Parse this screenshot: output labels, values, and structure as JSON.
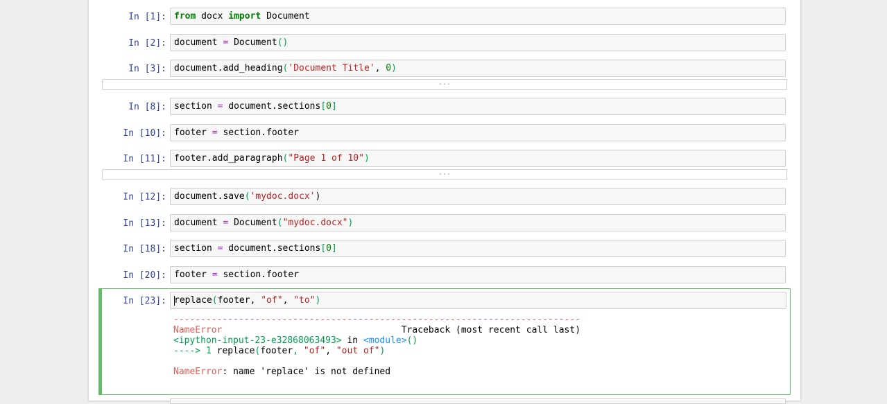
{
  "cells": [
    {
      "prompt": "In [1]:",
      "code": [
        [
          "from",
          "kw"
        ],
        [
          " docx ",
          ""
        ],
        [
          "import",
          "kw"
        ],
        [
          " Document",
          ""
        ]
      ]
    },
    {
      "prompt": "In [2]:",
      "code": [
        [
          "document ",
          ""
        ],
        [
          "=",
          "op"
        ],
        [
          " Document",
          ""
        ],
        [
          "()",
          "grn"
        ]
      ]
    },
    {
      "prompt": "In [3]:",
      "code": [
        [
          "document.add_heading",
          ""
        ],
        [
          "(",
          "grn"
        ],
        [
          "'Document Title'",
          "str"
        ],
        [
          ", ",
          ""
        ],
        [
          "0",
          "num"
        ],
        [
          ")",
          "grn"
        ]
      ]
    },
    {
      "prompt": "In [8]:",
      "code": [
        [
          "section ",
          ""
        ],
        [
          "=",
          "op"
        ],
        [
          " document.sections",
          ""
        ],
        [
          "[",
          "grn"
        ],
        [
          "0",
          "num"
        ],
        [
          "]",
          "grn"
        ]
      ]
    },
    {
      "prompt": "In [10]:",
      "code": [
        [
          "footer ",
          ""
        ],
        [
          "=",
          "op"
        ],
        [
          " section.footer",
          ""
        ]
      ]
    },
    {
      "prompt": "In [11]:",
      "code": [
        [
          "footer.add_paragraph",
          ""
        ],
        [
          "(",
          "grn"
        ],
        [
          "\"Page 1 of 10\"",
          "str"
        ],
        [
          ")",
          "grn"
        ]
      ]
    },
    {
      "prompt": "In [12]:",
      "code": [
        [
          "document.save",
          ""
        ],
        [
          "(",
          "grn"
        ],
        [
          "'mydoc.docx'",
          "str"
        ],
        [
          ")",
          ""
        ]
      ]
    },
    {
      "prompt": "In [13]:",
      "code": [
        [
          "document ",
          ""
        ],
        [
          "=",
          "op"
        ],
        [
          " Document",
          ""
        ],
        [
          "(",
          "grn"
        ],
        [
          "\"mydoc.docx\"",
          "str"
        ],
        [
          ")",
          "grn"
        ]
      ]
    },
    {
      "prompt": "In [18]:",
      "code": [
        [
          "section ",
          ""
        ],
        [
          "=",
          "op"
        ],
        [
          " document.sections",
          ""
        ],
        [
          "[",
          "grn"
        ],
        [
          "0",
          "num"
        ],
        [
          "]",
          "grn"
        ]
      ]
    },
    {
      "prompt": "In [20]:",
      "code": [
        [
          "footer ",
          ""
        ],
        [
          "=",
          "op"
        ],
        [
          " section.footer",
          ""
        ]
      ]
    }
  ],
  "collapsed_marker": "...",
  "active_cell": {
    "prompt": "In [23]:",
    "code": [
      [
        "replace",
        ""
      ],
      [
        "(",
        "grn"
      ],
      [
        "footer, ",
        ""
      ],
      [
        "\"of\"",
        "str"
      ],
      [
        ", ",
        ""
      ],
      [
        "\"to\"",
        "str"
      ],
      [
        ")",
        "grn"
      ]
    ]
  },
  "traceback": {
    "separator": "---------------------------------------------------------------------------",
    "error_name": "NameError",
    "traceback_header": "Traceback (most recent call last)",
    "location_file": "<ipython-input-23-e32868063493>",
    "location_in": " in ",
    "location_module": "<module>",
    "location_paren": "()",
    "arrow": "----> 1 ",
    "call_line": [
      [
        "replace",
        ""
      ],
      [
        "(",
        "grn"
      ],
      [
        "footer",
        ""
      ],
      [
        ", ",
        "grn"
      ],
      [
        "\"of\"",
        "str"
      ],
      [
        ", ",
        ""
      ],
      [
        "\"out of\"",
        "str"
      ],
      [
        ")",
        "grn"
      ]
    ],
    "message_name": "NameError",
    "message_text": ": name 'replace' is not defined"
  }
}
